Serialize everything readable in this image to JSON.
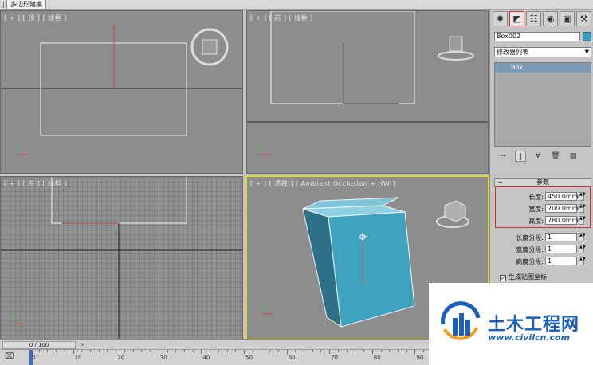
{
  "ribbon": {
    "tab_label": "多边形建模"
  },
  "viewports": {
    "top": {
      "label": "[ + ] [ 顶 ] [ 线框 ]"
    },
    "front": {
      "label": "[ + ] [ 前 ] [ 线框 ]"
    },
    "left": {
      "label": "[ + ] [ 左 ] [ 线框 ]"
    },
    "persp": {
      "label": "[ + ] [ 透视 ] [ Ambient Occlusion + HW ]"
    }
  },
  "command_panel": {
    "tabs": [
      {
        "icon": "create-icon",
        "glyph": "✹"
      },
      {
        "icon": "modify-icon",
        "glyph": "◩"
      },
      {
        "icon": "hierarchy-icon",
        "glyph": "☷"
      },
      {
        "icon": "motion-icon",
        "glyph": "◉"
      },
      {
        "icon": "display-icon",
        "glyph": "▣"
      },
      {
        "icon": "utilities-icon",
        "glyph": "⚒"
      }
    ],
    "object_name": "Box002",
    "object_color": "#2aa0c8",
    "modifier_list": "修改器列表",
    "stack_items": [
      "Box"
    ],
    "rollout_title": "参数",
    "params": [
      {
        "label": "长度:",
        "value": "450.0mm"
      },
      {
        "label": "宽度:",
        "value": "700.0mm"
      },
      {
        "label": "高度:",
        "value": "780.0mm"
      },
      {
        "label": "长度分段:",
        "value": "1"
      },
      {
        "label": "宽度分段:",
        "value": "1"
      },
      {
        "label": "高度分段:",
        "value": "1"
      }
    ],
    "gen_mapping_label": "生成贴图坐标"
  },
  "timeline": {
    "frame_text": "0 / 100",
    "prev": "<",
    "next": ">"
  },
  "ruler": {
    "numbers": [
      "0",
      "10",
      "20",
      "30",
      "40",
      "50",
      "60",
      "70",
      "80",
      "90"
    ]
  },
  "watermark": {
    "name": "土木工程网",
    "url": "www.civilcn.com"
  },
  "colors": {
    "viewport_bg": "#8d8d8d",
    "active_border": "#e4d63a",
    "box_color": "#3fa3bf",
    "highlight": "#d03030"
  }
}
